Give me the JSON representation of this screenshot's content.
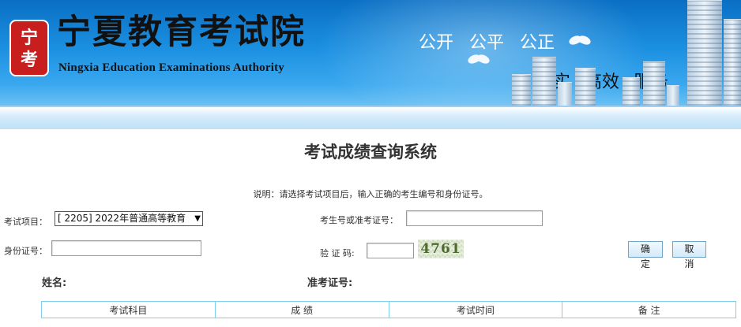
{
  "banner": {
    "seal_chars": [
      "宁",
      "考"
    ],
    "logo_cn": "宁夏教育考试院",
    "logo_en": "Ningxia Education Examinations Authority",
    "slogan_top": [
      "公开",
      "公平",
      "公正"
    ],
    "slogan_bottom": [
      "诚实",
      "高效",
      "服务"
    ]
  },
  "page_title": "考试成绩查询系统",
  "instruction": "说明：请选择考试项目后，输入正确的考生编号和身份证号。",
  "form": {
    "exam_item_label": "考试项目：",
    "exam_item_value": "[ 2205] 2022年普通高等教育",
    "candidate_no_label": "考生号或准考证号：",
    "candidate_no_value": "",
    "id_label": "身份证号：",
    "id_value": "",
    "captcha_label": "验 证 码:",
    "captcha_value": "",
    "captcha_image_text": "4761",
    "confirm_button": "确 定",
    "cancel_button": "取 消"
  },
  "result": {
    "name_label": "姓名:",
    "ticket_label": "准考证号:",
    "columns": [
      "考试科目",
      "成 绩",
      "考试时间",
      "备 注"
    ]
  },
  "colors": {
    "banner_blue": "#1b8fe0",
    "table_border": "#7fd0ec",
    "button_border": "#6fa6c8"
  }
}
